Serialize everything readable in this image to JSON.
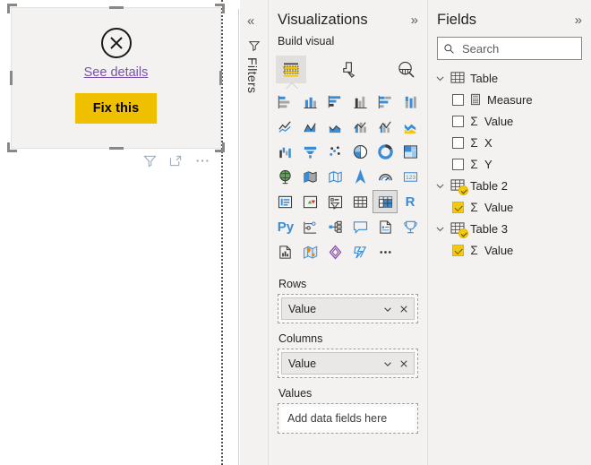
{
  "canvas": {
    "visual": {
      "error_icon": "error-circle-x-icon",
      "see_details_link": "See details",
      "fix_button": "Fix this",
      "button_color": "#EFC000",
      "link_color": "#7A52A8",
      "background": "#F3F2F1"
    },
    "footer_icons": [
      {
        "name": "filter-icon",
        "label": "Filters"
      },
      {
        "name": "focus-mode-icon",
        "label": "Focus mode"
      },
      {
        "name": "more-options-icon",
        "label": "More options"
      }
    ]
  },
  "filters_rail": {
    "collapse_icon": "«",
    "funnel_icon": "filter-funnel-icon",
    "label": "Filters"
  },
  "visualizations": {
    "title": "Visualizations",
    "expand_icon": "»",
    "build_label": "Build visual",
    "tabs": [
      {
        "name": "build-visual-tab",
        "icon": "build-visual-icon",
        "selected": true
      },
      {
        "name": "format-tab",
        "icon": "paintbrush-icon",
        "selected": false
      },
      {
        "name": "analytics-tab",
        "icon": "analytics-magnifier-icon",
        "selected": false
      }
    ],
    "accent_blue": "#3C8CD4",
    "accent_yellow": "#F2C811",
    "icons": [
      "stacked-bar-chart-icon",
      "stacked-column-chart-icon",
      "clustered-bar-chart-icon",
      "clustered-column-chart-icon",
      "100-stacked-bar-chart-icon",
      "100-stacked-column-chart-icon",
      "line-chart-icon",
      "area-chart-icon",
      "stacked-area-chart-icon",
      "line-stacked-column-chart-icon",
      "line-clustered-column-chart-icon",
      "ribbon-chart-icon",
      "waterfall-chart-icon",
      "funnel-chart-icon",
      "scatter-chart-icon",
      "pie-chart-icon",
      "donut-chart-icon",
      "treemap-icon",
      "map-icon",
      "filled-map-icon",
      "shape-map-icon",
      "azure-map-icon",
      "gauge-icon",
      "card-icon",
      "multi-row-card-icon",
      "kpi-icon",
      "slicer-icon",
      "table-icon",
      "matrix-icon",
      "r-script-visual-icon",
      "python-script-visual-icon",
      "key-influencers-icon",
      "decomposition-tree-icon",
      "qa-visual-icon",
      "narrative-icon",
      "metrics-icon",
      "paginated-report-icon",
      "arcgis-map-icon",
      "power-apps-icon",
      "power-automate-icon",
      "more-visuals-icon"
    ],
    "selected_icon": "matrix-icon",
    "wells": [
      {
        "name": "rows-well",
        "label": "Rows",
        "field": "Value",
        "empty": false
      },
      {
        "name": "columns-well",
        "label": "Columns",
        "field": "Value",
        "empty": false
      },
      {
        "name": "values-well",
        "label": "Values",
        "placeholder": "Add data fields here",
        "empty": true
      }
    ],
    "pill_icons": {
      "dropdown": "chevron-down-icon",
      "remove": "close-icon"
    }
  },
  "fields": {
    "title": "Fields",
    "expand_icon": "»",
    "search": {
      "placeholder": "Search",
      "value": "",
      "icon": "search-icon"
    },
    "tree": [
      {
        "name": "Table",
        "icon": "table-icon",
        "expanded": true,
        "badge": false,
        "children": [
          {
            "name": "Measure",
            "icon": "measure-calculator-icon",
            "checked": false,
            "aggregate": false
          },
          {
            "name": "Value",
            "icon": "sigma-icon",
            "checked": false,
            "aggregate": true
          },
          {
            "name": "X",
            "icon": "sigma-icon",
            "checked": false,
            "aggregate": true
          },
          {
            "name": "Y",
            "icon": "sigma-icon",
            "checked": false,
            "aggregate": true
          }
        ]
      },
      {
        "name": "Table 2",
        "icon": "table-icon",
        "expanded": true,
        "badge": true,
        "children": [
          {
            "name": "Value",
            "icon": "sigma-icon",
            "checked": true,
            "aggregate": true
          }
        ]
      },
      {
        "name": "Table 3",
        "icon": "table-icon",
        "expanded": true,
        "badge": true,
        "children": [
          {
            "name": "Value",
            "icon": "sigma-icon",
            "checked": true,
            "aggregate": true
          }
        ]
      }
    ]
  }
}
